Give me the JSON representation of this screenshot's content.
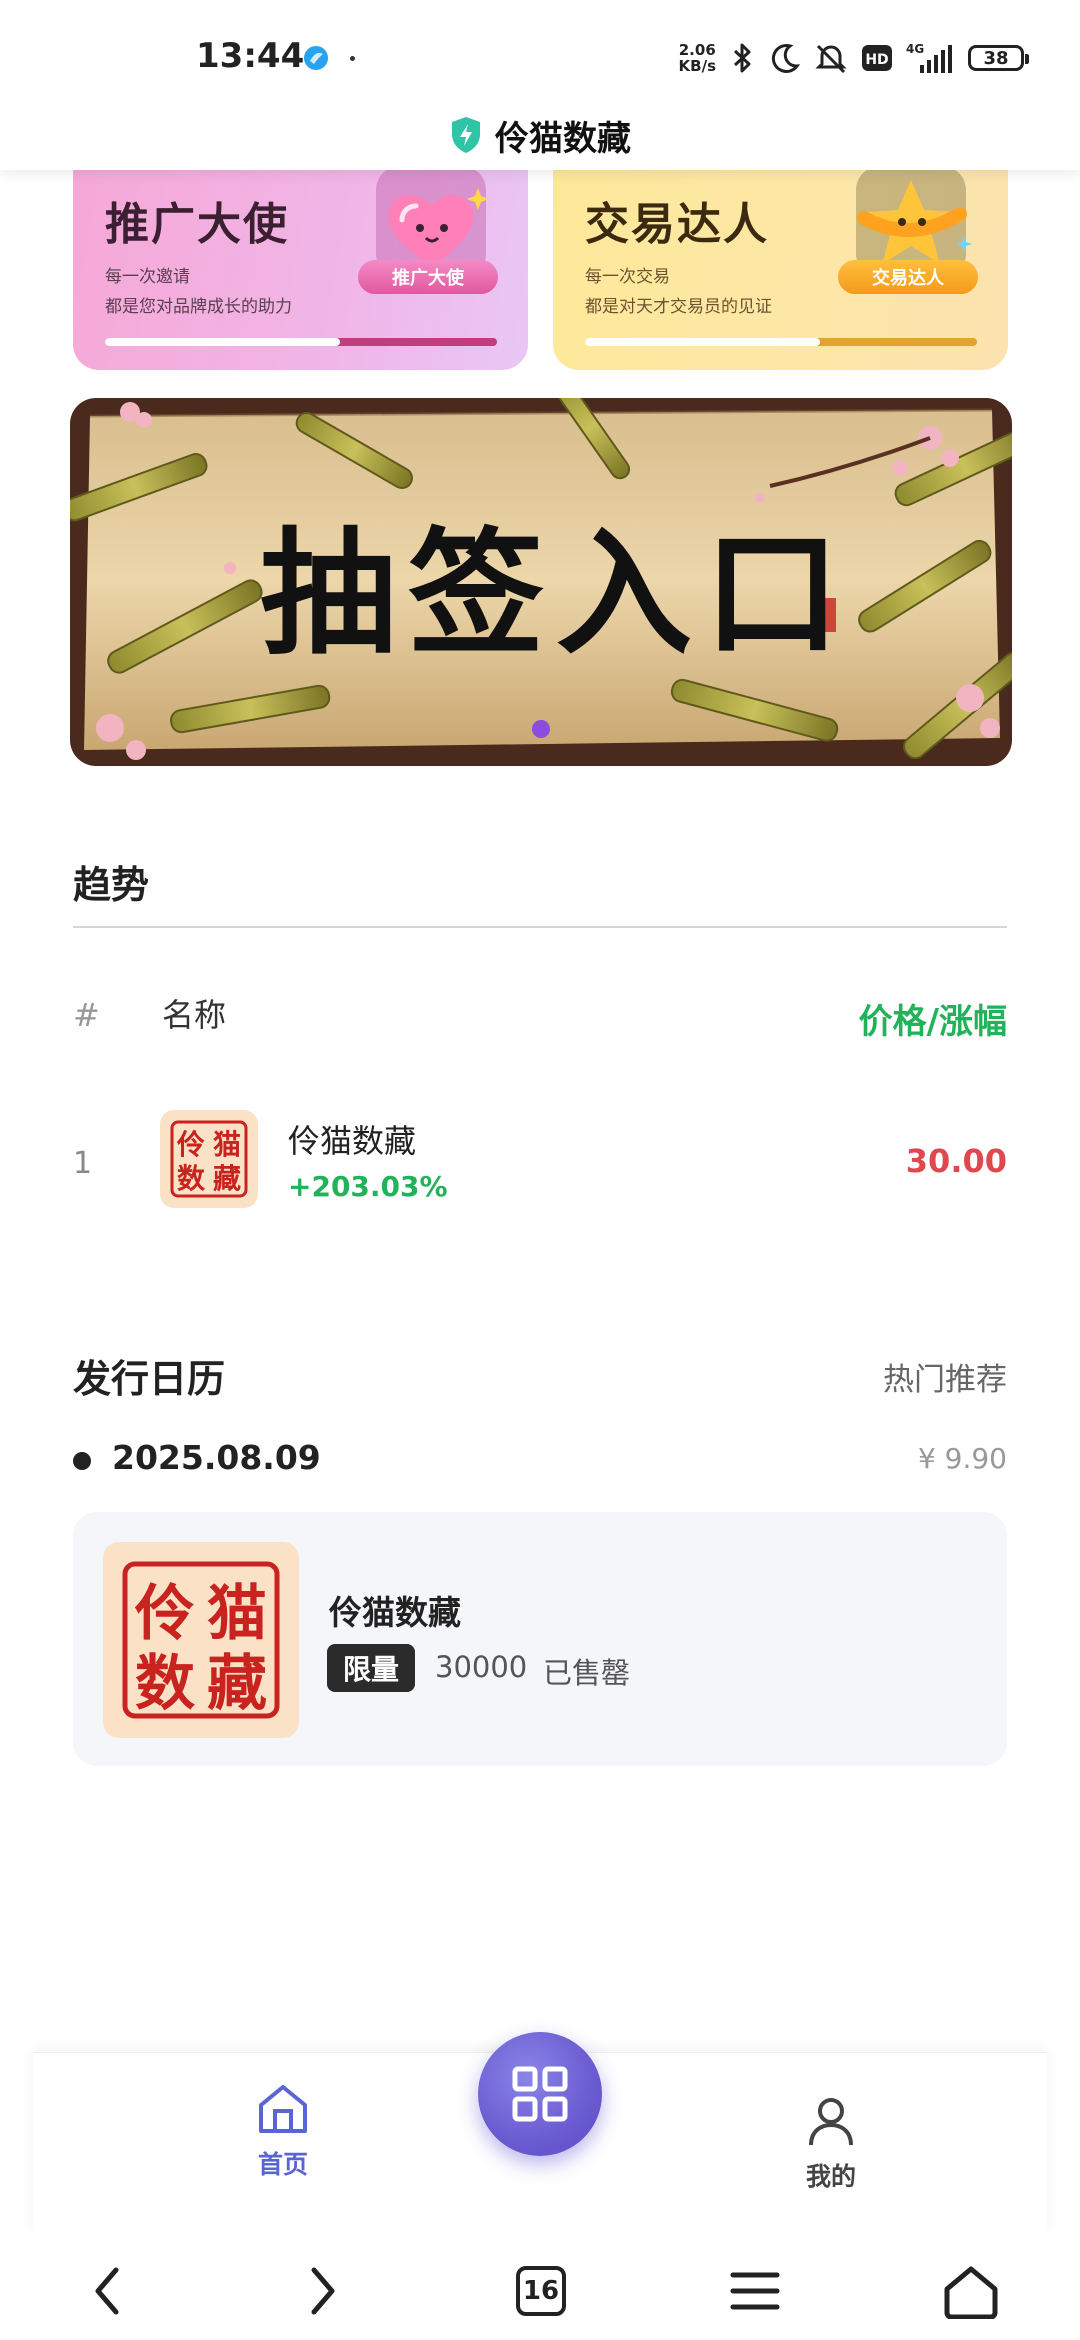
{
  "status_bar": {
    "time": "13:44",
    "speed_value": "2.06",
    "speed_unit": "KB/s",
    "network": "4G",
    "hd": "HD",
    "battery": "38"
  },
  "header": {
    "title": "伶猫数藏"
  },
  "promos": [
    {
      "title": "推广大使",
      "line1": "每一次邀请",
      "line2": "都是您对品牌成长的助力",
      "badge": "推广大使",
      "progress": 0.6
    },
    {
      "title": "交易达人",
      "line1": "每一次交易",
      "line2": "都是对天才交易员的见证",
      "badge": "交易达人",
      "progress": 0.6
    }
  ],
  "banner": {
    "title": "抽签入口"
  },
  "trend": {
    "title": "趋势",
    "columns": {
      "rank": "#",
      "name": "名称",
      "price": "价格/涨幅"
    },
    "rows": [
      {
        "rank": "1",
        "name": "伶猫数藏",
        "change": "+203.03%",
        "price": "30.00",
        "seal": [
          "伶",
          "猫",
          "数",
          "藏"
        ]
      }
    ]
  },
  "calendar": {
    "title": "发行日历",
    "hot": "热门推荐",
    "date": "2025.08.09",
    "price": "¥ 9.90",
    "item": {
      "name": "伶猫数藏",
      "badge": "限量",
      "count": "30000",
      "status": "已售罄",
      "seal": [
        "伶",
        "猫",
        "数",
        "藏"
      ]
    }
  },
  "tabbar": {
    "home": "首页",
    "mine": "我的"
  },
  "system_nav": {
    "tab_count": "16"
  },
  "colors": {
    "accent": "#5b64d4",
    "up_green": "#21b25a",
    "price_red": "#e0474f",
    "fab": "#6a5bd1",
    "seal_red": "#c8231f"
  }
}
